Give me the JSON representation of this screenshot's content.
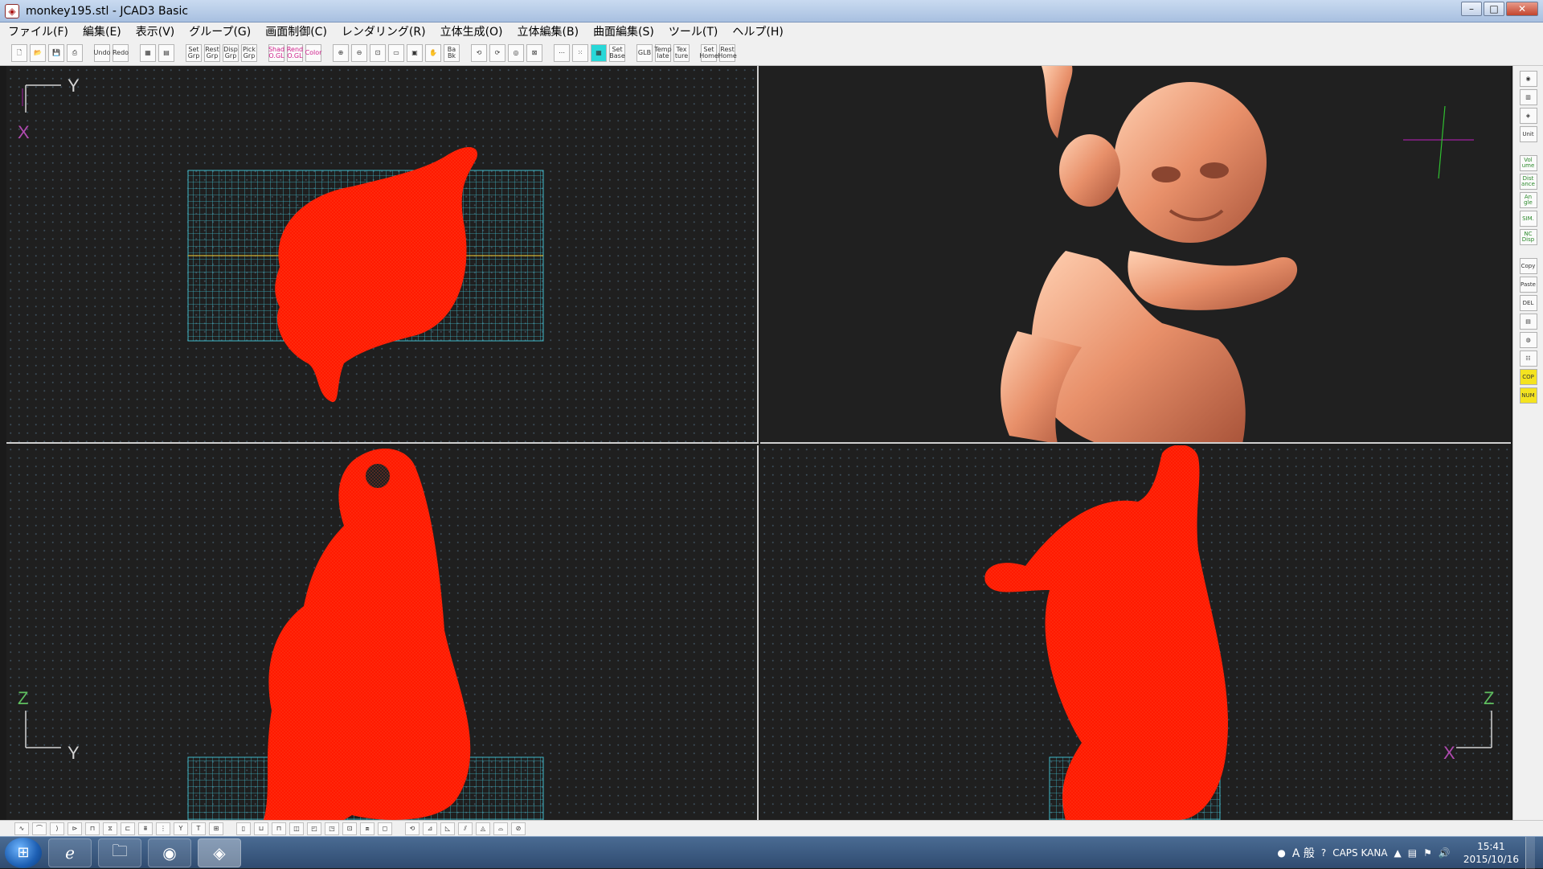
{
  "window": {
    "title": "monkey195.stl - JCAD3 Basic",
    "controls": {
      "minimize": "–",
      "maximize": "□",
      "close": "✕"
    }
  },
  "menu": [
    "ファイル(F)",
    "編集(E)",
    "表示(V)",
    "グループ(G)",
    "画面制御(C)",
    "レンダリング(R)",
    "立体生成(O)",
    "立体編集(B)",
    "曲面編集(S)",
    "ツール(T)",
    "ヘルプ(H)"
  ],
  "toolbar": {
    "buttons": [
      "",
      "",
      "",
      "",
      "Undo",
      "Redo",
      "",
      "",
      "Set Grp",
      "Rest Grp",
      "Disp Grp",
      "Pick Grp",
      "Shad O.GL",
      "Rend O.GL",
      "Color",
      "",
      "",
      "",
      "",
      "",
      "",
      "",
      "Ba Bk",
      "",
      "",
      "",
      "",
      "",
      "",
      "",
      "Set Base",
      "GLB",
      "Temp late",
      "Tex ture",
      "Set Home",
      "Rest Home"
    ]
  },
  "viewports": {
    "top": {
      "axis_h": "Y",
      "axis_v": "X"
    },
    "front": {
      "axis_v": "Z",
      "axis_h": "Y"
    },
    "side": {
      "axis_v": "Z",
      "axis_h": "X"
    }
  },
  "right_tools": [
    "Vol ume",
    "Dist ance",
    "An gle",
    "SIM.",
    "NC Disp",
    "Copy",
    "Paste",
    "DEL",
    "COP",
    "NUM"
  ],
  "taskbar": {
    "ime_mode": "A 般",
    "caps": "CAPS KANA",
    "time": "15:41",
    "date": "2015/10/16"
  },
  "colors": {
    "wireframe": "#ff1a00",
    "grid_plate": "#3fb9c9",
    "render": "#e8906a",
    "axis": "#d4d4d4"
  }
}
